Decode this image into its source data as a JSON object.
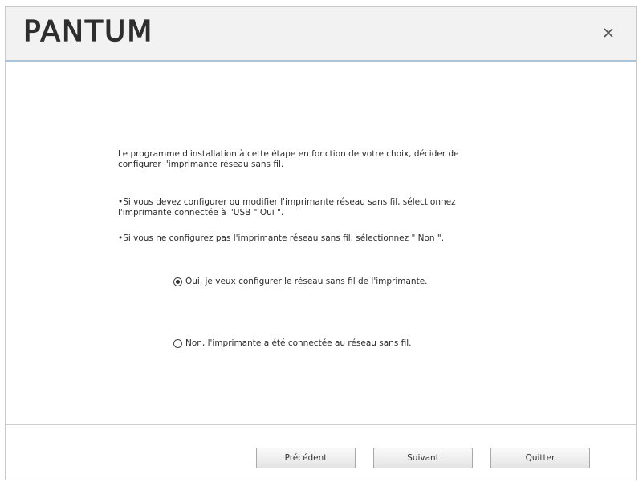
{
  "header": {
    "logo_text": "PANTUM",
    "close_glyph": "×"
  },
  "content": {
    "intro": "Le programme d'installation à cette étape en fonction de votre choix, décider de configurer l'imprimante réseau sans fil.",
    "bullet_yes": "•Si vous devez configurer ou modifier l'imprimante réseau sans fil, sélectionnez l'imprimante connectée à l'USB \" Oui \".",
    "bullet_no": "•Si vous ne configurez pas l'imprimante réseau sans fil, sélectionnez \" Non \".",
    "options": [
      {
        "label": "Oui, je veux configurer le réseau sans fil de l'imprimante.",
        "selected": true
      },
      {
        "label": "Non, l'imprimante a été connectée au réseau sans fil.",
        "selected": false
      }
    ]
  },
  "footer": {
    "prev_label": "Précédent",
    "next_label": "Suivant",
    "quit_label": "Quitter"
  },
  "colors": {
    "header_bg": "#f2f2f2",
    "header_border": "#a9c3d8",
    "text": "#2b2b2b"
  },
  "icons": {
    "close": "close-icon",
    "radio_selected": "radio-selected-icon",
    "radio_unselected": "radio-unselected-icon"
  }
}
